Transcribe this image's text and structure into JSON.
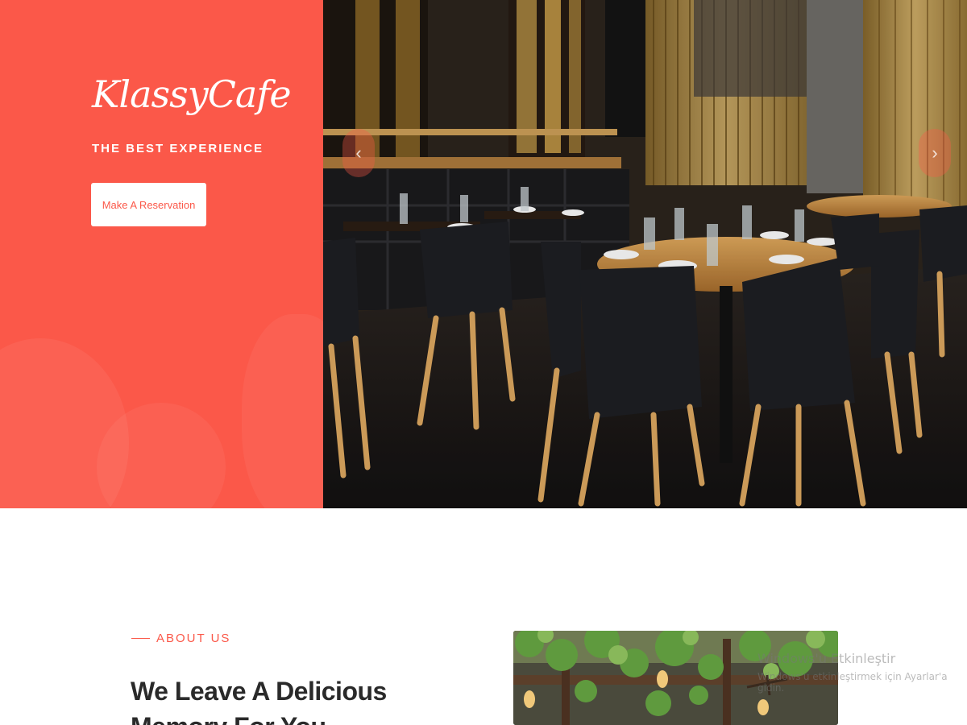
{
  "brand": {
    "logo": "KlassyCafe",
    "tagline": "THE BEST EXPERIENCE",
    "accent_color": "#fb5849"
  },
  "hero": {
    "cta_label": "Make A Reservation",
    "prev_icon": "‹",
    "next_icon": "›"
  },
  "about": {
    "section_label": "ABOUT US",
    "heading": "We Leave A Delicious Memory For You"
  },
  "watermark": {
    "title": "Windows'u Etkinleştir",
    "subtitle": "Windows'u etkinleştirmek için Ayarlar'a gidin."
  }
}
